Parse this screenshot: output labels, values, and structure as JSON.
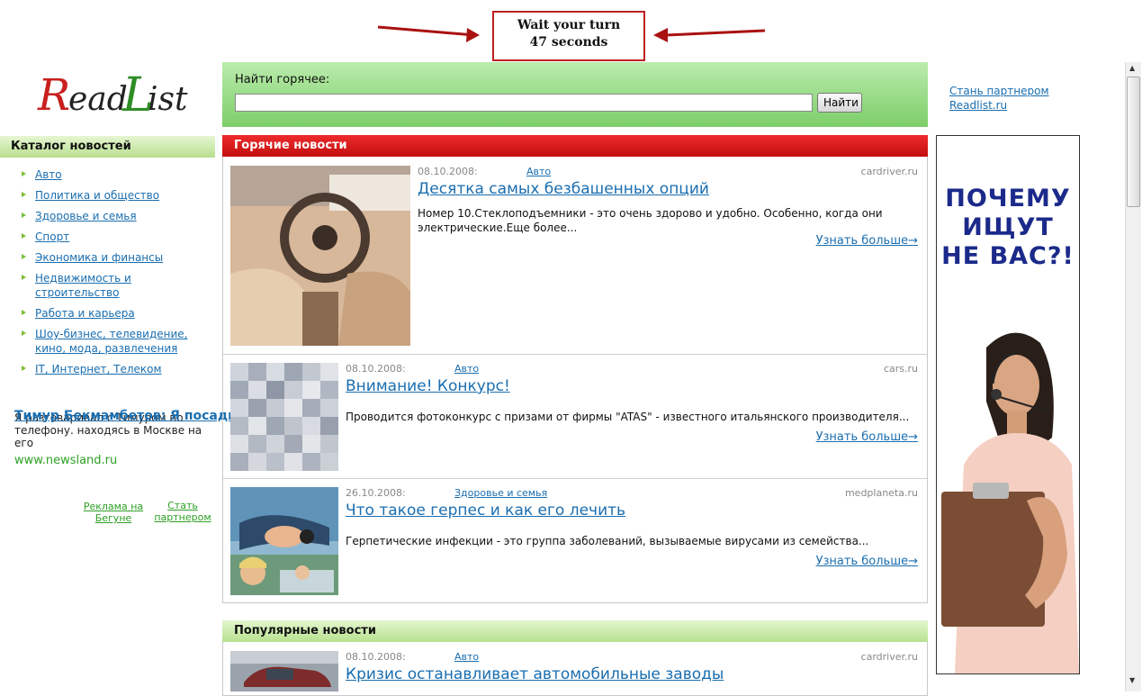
{
  "notice": {
    "line1": "Wait your turn",
    "line2": "47 seconds"
  },
  "logo": {
    "text_r": "R",
    "text_ead": "ead",
    "text_l": "L",
    "text_ist": "ist"
  },
  "search": {
    "label": "Найти горячее:",
    "value": "",
    "button": "Найти"
  },
  "partner_top": {
    "line1": "Стань партнером",
    "line2": "Readlist.ru"
  },
  "catalog": {
    "title": "Каталог новостей",
    "items": [
      "Авто",
      "Политика и общество",
      "Здоровье и семья",
      "Спорт",
      "Экономика и финансы",
      "Недвижимость и строительство",
      "Работа и карьера",
      "Шоу-бизнес, телевидение, кино, мода, развлечения",
      "IT, Интернет, Телеком"
    ]
  },
  "promo": {
    "title": "Тимур Бекмамбетов: Я посадил",
    "body": "Я разговаривал с Тимуром по телефону. находясь в Москве на его",
    "url": "www.newsland.ru",
    "ad_link": "Реклама на Бегуне",
    "partner_link": "Стать партнером"
  },
  "hot": {
    "title": "Горячие новости",
    "items": [
      {
        "date": "08.10.2008:",
        "category": "Авто",
        "source": "cardriver.ru",
        "title": "Десятка самых безбашенных опций",
        "desc": "Номер 10.Стеклоподъемники - это очень здорово и удобно. Особенно, когда они электрические.Еще более...",
        "more": "Узнать больше→"
      },
      {
        "date": "08.10.2008:",
        "category": "Авто",
        "source": "cars.ru",
        "title": "Внимание! Конкурс!",
        "desc": "Проводится фотоконкурс с призами от фирмы \"ATAS\" - известного итальянского производителя...",
        "more": "Узнать больше→"
      },
      {
        "date": "26.10.2008:",
        "category": "Здоровье и семья",
        "source": "medplaneta.ru",
        "title": "Что такое герпес и как его лечить",
        "desc": "Герпетические инфекции - это группа заболеваний, вызываемые вирусами из семейства...",
        "more": "Узнать больше→"
      }
    ]
  },
  "popular": {
    "title": "Популярные новости",
    "items": [
      {
        "date": "08.10.2008:",
        "category": "Авто",
        "source": "cardriver.ru",
        "title": "Кризис останавливает автомобильные заводы"
      }
    ]
  },
  "banner": {
    "line1": "ПОЧЕМУ",
    "line2": "ИЩУТ",
    "line3": "НЕ ВАС?!"
  }
}
